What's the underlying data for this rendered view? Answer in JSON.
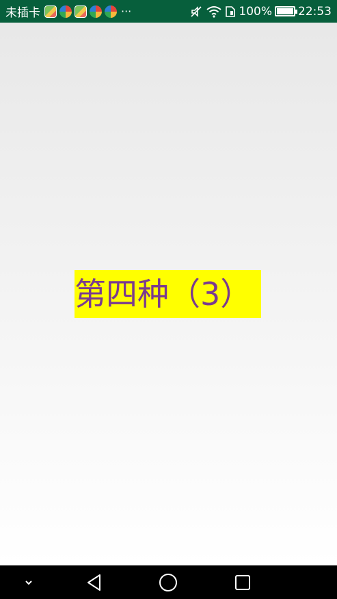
{
  "status_bar": {
    "carrier": "未插卡",
    "more": "···",
    "battery_percent": "100%",
    "battery_level": 1.0,
    "time": "22:53",
    "icons": [
      "app-square-icon",
      "app-round-icon",
      "app-square-icon",
      "app-round-icon",
      "app-round-icon",
      "mute-icon",
      "wifi-icon",
      "sim-icon",
      "battery-icon"
    ],
    "background_color": "#075f3c"
  },
  "main": {
    "label": "第四种（3）",
    "label_background": "#ffff00",
    "label_color": "#7a3b8f"
  },
  "nav_bar": {
    "buttons": [
      "hide-keyboard-icon",
      "back-icon",
      "home-icon",
      "recents-icon"
    ]
  }
}
